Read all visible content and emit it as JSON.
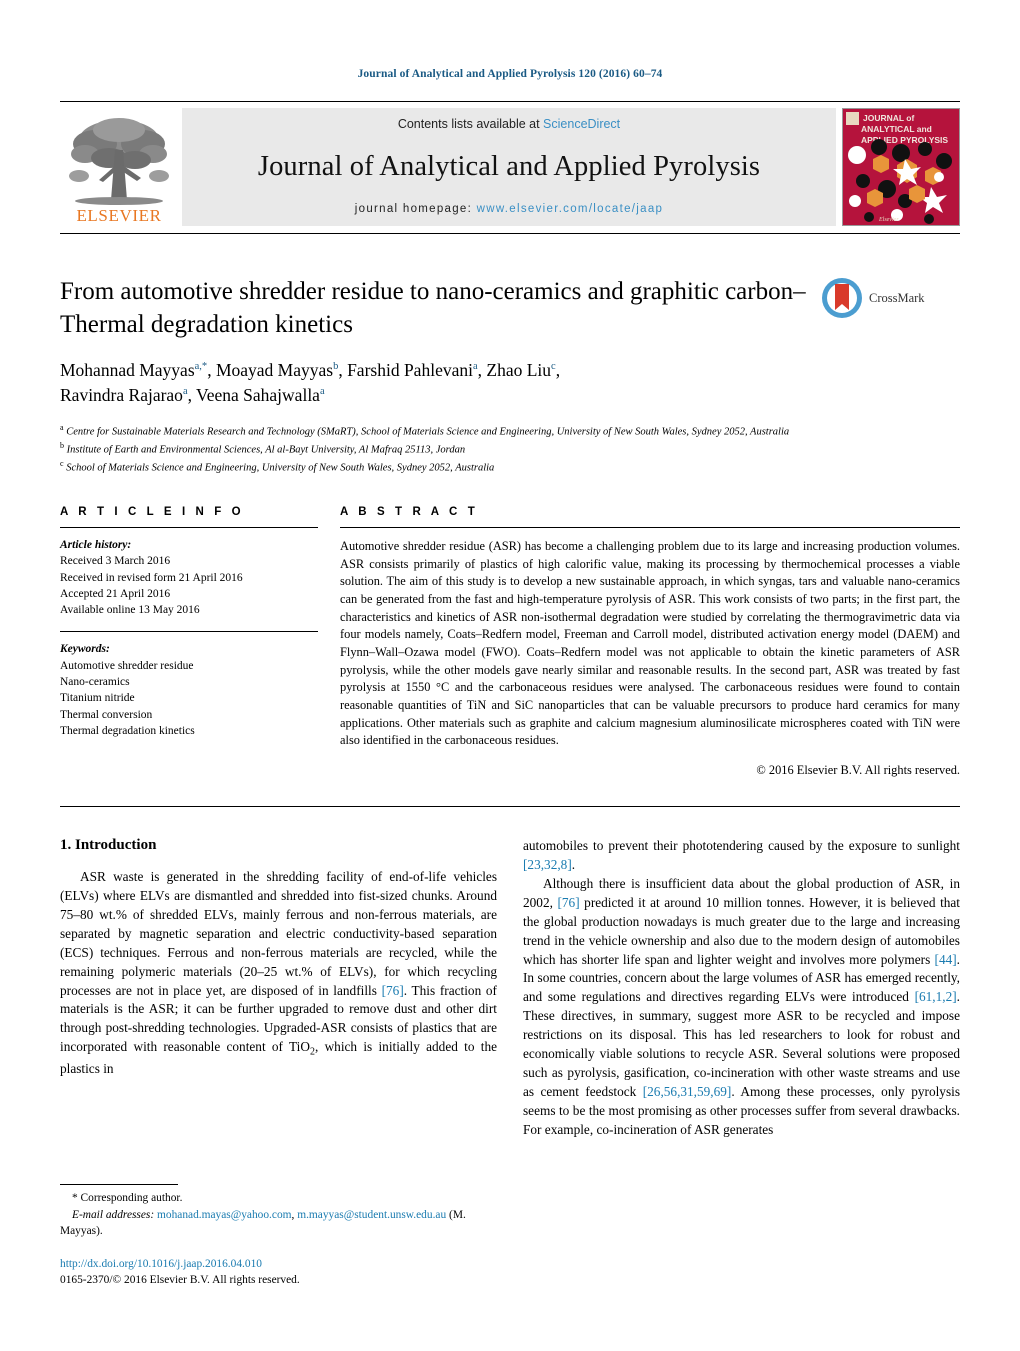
{
  "running_head": "Journal of Analytical and Applied Pyrolysis 120 (2016) 60–74",
  "masthead": {
    "publisher_name": "ELSEVIER",
    "contents_prefix": "Contents lists available at ",
    "contents_link": "ScienceDirect",
    "journal_title": "Journal of Analytical and Applied Pyrolysis",
    "homepage_prefix": "journal homepage: ",
    "homepage_url": "www.elsevier.com/locate/jaap",
    "cover_title_line1": "JOURNAL of",
    "cover_title_line2": "ANALYTICAL and",
    "cover_title_line3": "APPLIED PYROLYSIS"
  },
  "article": {
    "title": "From automotive shredder residue to nano-ceramics and graphitic carbon–Thermal degradation kinetics",
    "authors_line1": "Mohannad Mayyas",
    "authors_line1_sup": "a,*",
    "authors_line1_b": ", Moayad Mayyas",
    "authors_line1_b_sup": "b",
    "authors_line1_c": ", Farshid Pahlevani",
    "authors_line1_c_sup": "a",
    "authors_line1_d": ", Zhao Liu",
    "authors_line1_d_sup": "c",
    "authors_line1_end": ",",
    "authors_line2": "Ravindra Rajarao",
    "authors_line2_sup": "a",
    "authors_line2_b": ", Veena Sahajwalla",
    "authors_line2_b_sup": "a",
    "crossmark_label": "CrossMark",
    "affiliations": [
      {
        "marker": "a",
        "text": "Centre for Sustainable Materials Research and Technology (SMaRT), School of Materials Science and Engineering, University of New South Wales, Sydney 2052, Australia"
      },
      {
        "marker": "b",
        "text": "Institute of Earth and Environmental Sciences, Al al-Bayt University, Al Mafraq 25113, Jordan"
      },
      {
        "marker": "c",
        "text": "School of Materials Science and Engineering, University of New South Wales, Sydney 2052, Australia"
      }
    ]
  },
  "article_info": {
    "heading": "A R T I C L E   I N F O",
    "history_label": "Article history:",
    "history": [
      "Received 3 March 2016",
      "Received in revised form 21 April 2016",
      "Accepted 21 April 2016",
      "Available online 13 May 2016"
    ],
    "keywords_label": "Keywords:",
    "keywords": [
      "Automotive shredder residue",
      "Nano-ceramics",
      "Titanium nitride",
      "Thermal conversion",
      "Thermal degradation kinetics"
    ]
  },
  "abstract": {
    "heading": "A B S T R A C T",
    "text": "Automotive shredder residue (ASR) has become a challenging problem due to its large and increasing production volumes. ASR consists primarily of plastics of high calorific value, making its processing by thermochemical processes a viable solution. The aim of this study is to develop a new sustainable approach, in which syngas, tars and valuable nano-ceramics can be generated from the fast and high-temperature pyrolysis of ASR. This work consists of two parts; in the first part, the characteristics and kinetics of ASR non-isothermal degradation were studied by correlating the thermogravimetric data via four models namely, Coats–Redfern model, Freeman and Carroll model, distributed activation energy model (DAEM) and Flynn–Wall–Ozawa model (FWO). Coats–Redfern model was not applicable to obtain the kinetic parameters of ASR pyrolysis, while the other models gave nearly similar and reasonable results. In the second part, ASR was treated by fast pyrolysis at 1550 °C and the carbonaceous residues were analysed. The carbonaceous residues were found to contain reasonable quantities of TiN and SiC nanoparticles that can be valuable precursors to produce hard ceramics for many applications. Other materials such as graphite and calcium magnesium aluminosilicate microspheres coated with TiN were also identified in the carbonaceous residues.",
    "copyright": "© 2016 Elsevier B.V. All rights reserved."
  },
  "introduction": {
    "section_number": "1.",
    "section_title": "Introduction",
    "left_para_1a": "ASR waste is generated in the shredding facility of end-of-life vehicles (ELVs) where ELVs are dismantled and shredded into fist-sized chunks. Around 75–80 wt.% of shredded ELVs, mainly ferrous and non-ferrous materials, are separated by magnetic separation and electric conductivity-based separation (ECS) techniques. Ferrous and non-ferrous materials are recycled, while the remaining polymeric materials (20–25 wt.% of ELVs), for which recycling processes are not in place yet, are disposed of in landfills ",
    "left_ref_1": "[76]",
    "left_para_1b": ". This fraction of materials is the ASR; it can be further upgraded to remove dust and other dirt through post-shredding technologies. Upgraded-ASR consists of plastics that are incorporated with reasonable content of TiO",
    "left_sub": "2",
    "left_para_1c": ", which is initially added to the plastics in",
    "right_para_1a": "automobiles to prevent their phototendering caused by the exposure to sunlight ",
    "right_ref_1": "[23,32,8]",
    "right_para_1b": ".",
    "right_para_2a": "Although there is insufficient data about the global production of ASR, in 2002, ",
    "right_ref_2": "[76]",
    "right_para_2b": " predicted it at around 10 million tonnes. However, it is believed that the global production nowadays is much greater due to the large and increasing trend in the vehicle ownership and also due to the modern design of automobiles which has shorter life span and lighter weight and involves more polymers ",
    "right_ref_3": "[44]",
    "right_para_2c": ". In some countries, concern about the large volumes of ASR has emerged recently, and some regulations and directives regarding ELVs were introduced ",
    "right_ref_4": "[61,1,2]",
    "right_para_2d": ". These directives, in summary, suggest more ASR to be recycled and impose restrictions on its disposal. This has led researchers to look for robust and economically viable solutions to recycle ASR. Several solutions were proposed such as pyrolysis, gasification, co-incineration with other waste streams and use as cement feedstock ",
    "right_ref_5": "[26,56,31,59,69]",
    "right_para_2e": ". Among these processes, only pyrolysis seems to be the most promising as other processes suffer from several drawbacks. For example, co-incineration of ASR generates"
  },
  "footnote": {
    "corresponding": "* Corresponding author.",
    "email_label": "E-mail addresses:",
    "email_1": "mohanad.mayas@yahoo.com",
    "email_sep": ", ",
    "email_2": "m.mayyas@student.unsw.edu.au",
    "email_attrib": " (M. Mayyas).",
    "doi": "http://dx.doi.org/10.1016/j.jaap.2016.04.010",
    "issn_line": "0165-2370/© 2016 Elsevier B.V. All rights reserved."
  },
  "colors": {
    "link_blue": "#1a7bb0",
    "header_blue": "#1a5a84",
    "sciencedirect_blue": "#3a8fc4",
    "elsevier_orange": "#e87722",
    "cover_red": "#b5133c",
    "masthead_gray": "#e9e9e9"
  }
}
